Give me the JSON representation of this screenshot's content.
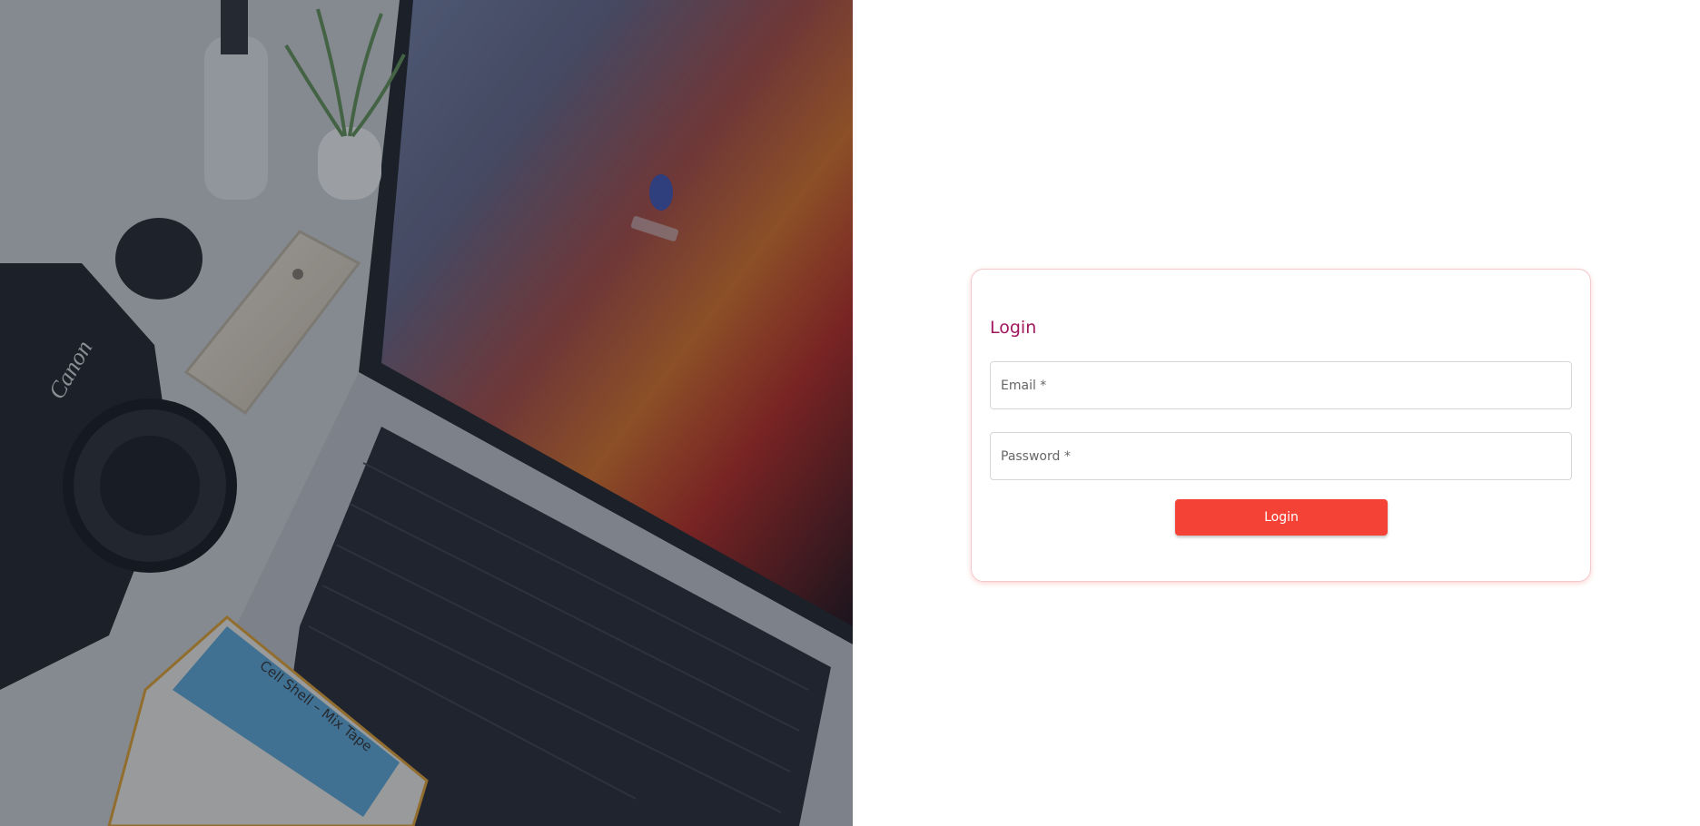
{
  "login": {
    "title": "Login",
    "email_placeholder": "Email *",
    "password_placeholder": "Password *",
    "submit_label": "Login"
  },
  "colors": {
    "accent": "#f44336",
    "title": "#a1175d",
    "card_border": "#f3c9cd"
  },
  "hero": {
    "image_subject": "desk-with-laptop-camera-phone",
    "camera_brand": "Canon",
    "cassette_label": "Cell Shell - Mix Tape"
  }
}
